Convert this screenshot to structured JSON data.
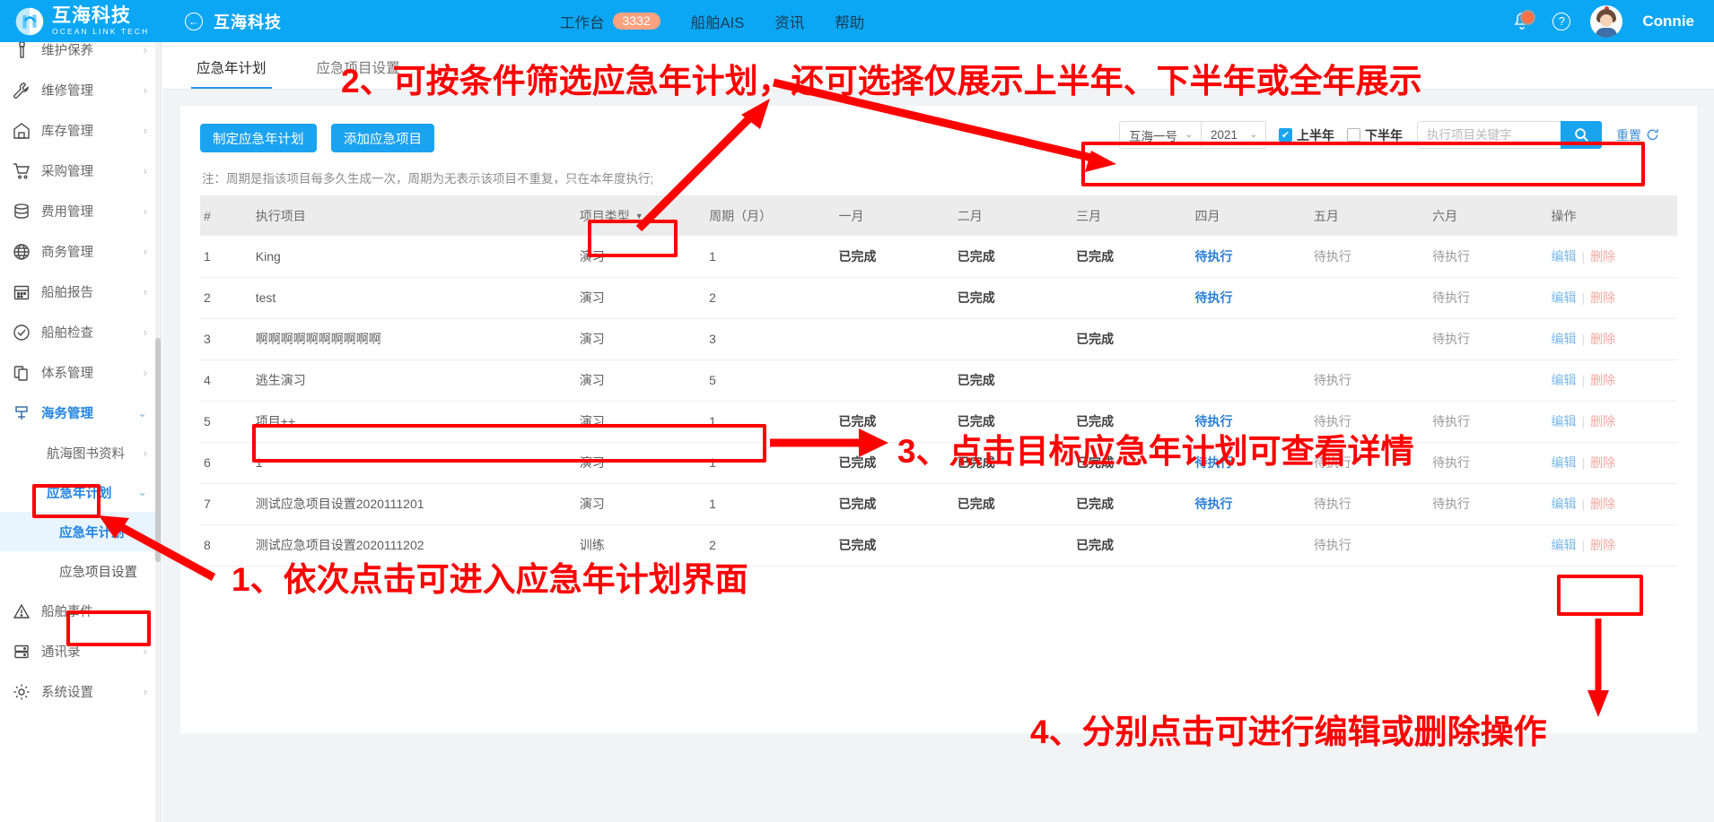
{
  "topbar": {
    "brand_cn": "互海科技",
    "brand_en": "OCEAN LINK TECH",
    "back_title": "互海科技",
    "nav": [
      {
        "label": "工作台",
        "badge": "3332"
      },
      {
        "label": "船舶AIS",
        "badge": ""
      },
      {
        "label": "资讯",
        "badge": ""
      },
      {
        "label": "帮助",
        "badge": ""
      }
    ],
    "username": "Connie"
  },
  "sidebar": {
    "items": [
      {
        "label": "维护保养",
        "icon": "wrench-upright-icon",
        "arrow": "›",
        "level": 1,
        "state": "normal"
      },
      {
        "label": "维修管理",
        "icon": "wrench-icon",
        "arrow": "›",
        "level": 1,
        "state": "normal"
      },
      {
        "label": "库存管理",
        "icon": "warehouse-icon",
        "arrow": "›",
        "level": 1,
        "state": "normal"
      },
      {
        "label": "采购管理",
        "icon": "cart-icon",
        "arrow": "›",
        "level": 1,
        "state": "normal"
      },
      {
        "label": "费用管理",
        "icon": "database-icon",
        "arrow": "›",
        "level": 1,
        "state": "normal"
      },
      {
        "label": "商务管理",
        "icon": "globe-icon",
        "arrow": "›",
        "level": 1,
        "state": "normal"
      },
      {
        "label": "船舶报告",
        "icon": "calendar-icon",
        "arrow": "›",
        "level": 1,
        "state": "normal"
      },
      {
        "label": "船舶检查",
        "icon": "check-circle-icon",
        "arrow": "›",
        "level": 1,
        "state": "normal"
      },
      {
        "label": "体系管理",
        "icon": "documents-icon",
        "arrow": "›",
        "level": 1,
        "state": "normal"
      },
      {
        "label": "海务管理",
        "icon": "anchor-icon",
        "arrow": "⌄",
        "level": 1,
        "state": "active"
      },
      {
        "label": "航海图书资料",
        "icon": "",
        "arrow": "›",
        "level": 2,
        "state": "normal"
      },
      {
        "label": "应急年计划",
        "icon": "",
        "arrow": "⌄",
        "level": 2,
        "state": "accent"
      },
      {
        "label": "应急年计划",
        "icon": "",
        "arrow": "",
        "level": 3,
        "state": "selected"
      },
      {
        "label": "应急项目设置",
        "icon": "",
        "arrow": "",
        "level": 3,
        "state": "plain"
      },
      {
        "label": "船舶事件",
        "icon": "warning-icon",
        "arrow": "",
        "level": 1,
        "state": "normal"
      },
      {
        "label": "通讯录",
        "icon": "contacts-icon",
        "arrow": "›",
        "level": 1,
        "state": "normal"
      },
      {
        "label": "系统设置",
        "icon": "gear-icon",
        "arrow": "›",
        "level": 1,
        "state": "normal"
      }
    ]
  },
  "tabs": [
    {
      "label": "应急年计划",
      "active": true
    },
    {
      "label": "应急项目设置",
      "active": false
    }
  ],
  "toolbar": {
    "make_plan_label": "制定应急年计划",
    "add_item_label": "添加应急项目",
    "ship_value": "互海一号",
    "year_value": "2021",
    "first_half_label": "上半年",
    "first_half_checked": true,
    "second_half_label": "下半年",
    "second_half_checked": false,
    "search_placeholder": "执行项目关键字",
    "search_value": "",
    "reset_label": "重置",
    "caret": "⌄",
    "check_mark": "✔"
  },
  "note": "注：周期是指该项目每多久生成一次，周期为无表示该项目不重复，只在本年度执行;",
  "table": {
    "headers": [
      "#",
      "执行项目",
      "项目类型",
      "周期（月）",
      "一月",
      "二月",
      "三月",
      "四月",
      "五月",
      "六月",
      "操作"
    ],
    "edit_label": "编辑",
    "delete_label": "删除",
    "rows": [
      {
        "idx": "1",
        "name": "King",
        "type": "演习",
        "cycle": "1",
        "months": [
          "已完成",
          "已完成",
          "已完成",
          "待执行",
          "待执行",
          "待执行"
        ]
      },
      {
        "idx": "2",
        "name": "test",
        "type": "演习",
        "cycle": "2",
        "months": [
          "",
          "已完成",
          "",
          "待执行",
          "",
          "待执行"
        ]
      },
      {
        "idx": "3",
        "name": "啊啊啊啊啊啊啊啊啊啊",
        "type": "演习",
        "cycle": "3",
        "months": [
          "",
          "",
          "已完成",
          "",
          "",
          "待执行"
        ]
      },
      {
        "idx": "4",
        "name": "逃生演习",
        "type": "演习",
        "cycle": "5",
        "months": [
          "",
          "已完成",
          "",
          "",
          "待执行",
          ""
        ]
      },
      {
        "idx": "5",
        "name": "项目++",
        "type": "演习",
        "cycle": "1",
        "months": [
          "已完成",
          "已完成",
          "已完成",
          "待执行",
          "待执行",
          "待执行"
        ]
      },
      {
        "idx": "6",
        "name": "1",
        "type": "演习",
        "cycle": "1",
        "months": [
          "已完成",
          "已完成",
          "已完成",
          "待执行",
          "待执行",
          "待执行"
        ]
      },
      {
        "idx": "7",
        "name": "测试应急项目设置2020111201",
        "type": "演习",
        "cycle": "1",
        "months": [
          "已完成",
          "已完成",
          "已完成",
          "待执行",
          "待执行",
          "待执行"
        ]
      },
      {
        "idx": "8",
        "name": "测试应急项目设置2020111202",
        "type": "训练",
        "cycle": "2",
        "months": [
          "已完成",
          "",
          "已完成",
          "",
          "待执行",
          ""
        ]
      }
    ],
    "status_done": "已完成",
    "status_todo": "待执行",
    "current_month_index": 3
  },
  "annotations": [
    {
      "id": "a1",
      "text": "1、依次点击可进入应急年计划界面"
    },
    {
      "id": "a2",
      "text": "2、可按条件筛选应急年计划，还可选择仅展示上半年、下半年或全年展示"
    },
    {
      "id": "a3",
      "text": "3、点击目标应急年计划可查看详情"
    },
    {
      "id": "a4",
      "text": "4、分别点击可进行编辑或删除操作"
    }
  ],
  "colors": {
    "brand_blue": "#0ba7f5",
    "accent_blue": "#2485e0",
    "annotation_red": "#fe0000",
    "badge_orange": "#ffa280"
  }
}
